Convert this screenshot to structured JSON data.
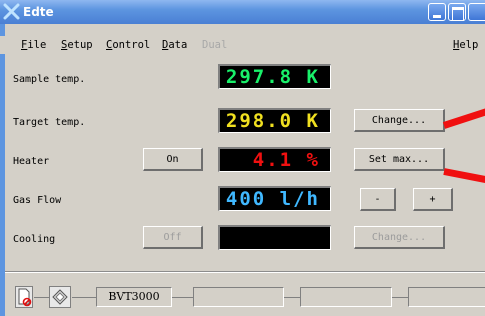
{
  "window": {
    "title": "Edte",
    "app_icon": "x-logo-icon"
  },
  "menu": {
    "file": "File",
    "setup": "Setup",
    "control": "Control",
    "data": "Data",
    "dual": "Dual",
    "help": "Help"
  },
  "rows": {
    "sample": {
      "label": "Sample temp.",
      "display": "297.8 K"
    },
    "target": {
      "label": "Target temp.",
      "display": "298.0 K",
      "button": "Change..."
    },
    "heater": {
      "label": "Heater",
      "toggle": "On",
      "display": "4.1 %",
      "button": "Set max..."
    },
    "gas": {
      "label": "Gas Flow",
      "display": "400 l/h",
      "minus": "-",
      "plus": "+"
    },
    "cooling": {
      "label": "Cooling",
      "toggle": "Off",
      "display": "",
      "button": "Change..."
    }
  },
  "status": {
    "device": "BVT3000"
  },
  "colors": {
    "sample": "#19f06a",
    "target": "#f0e020",
    "heater": "#f01010",
    "gas": "#40b8ff",
    "annotation_arrow": "#f01010"
  }
}
